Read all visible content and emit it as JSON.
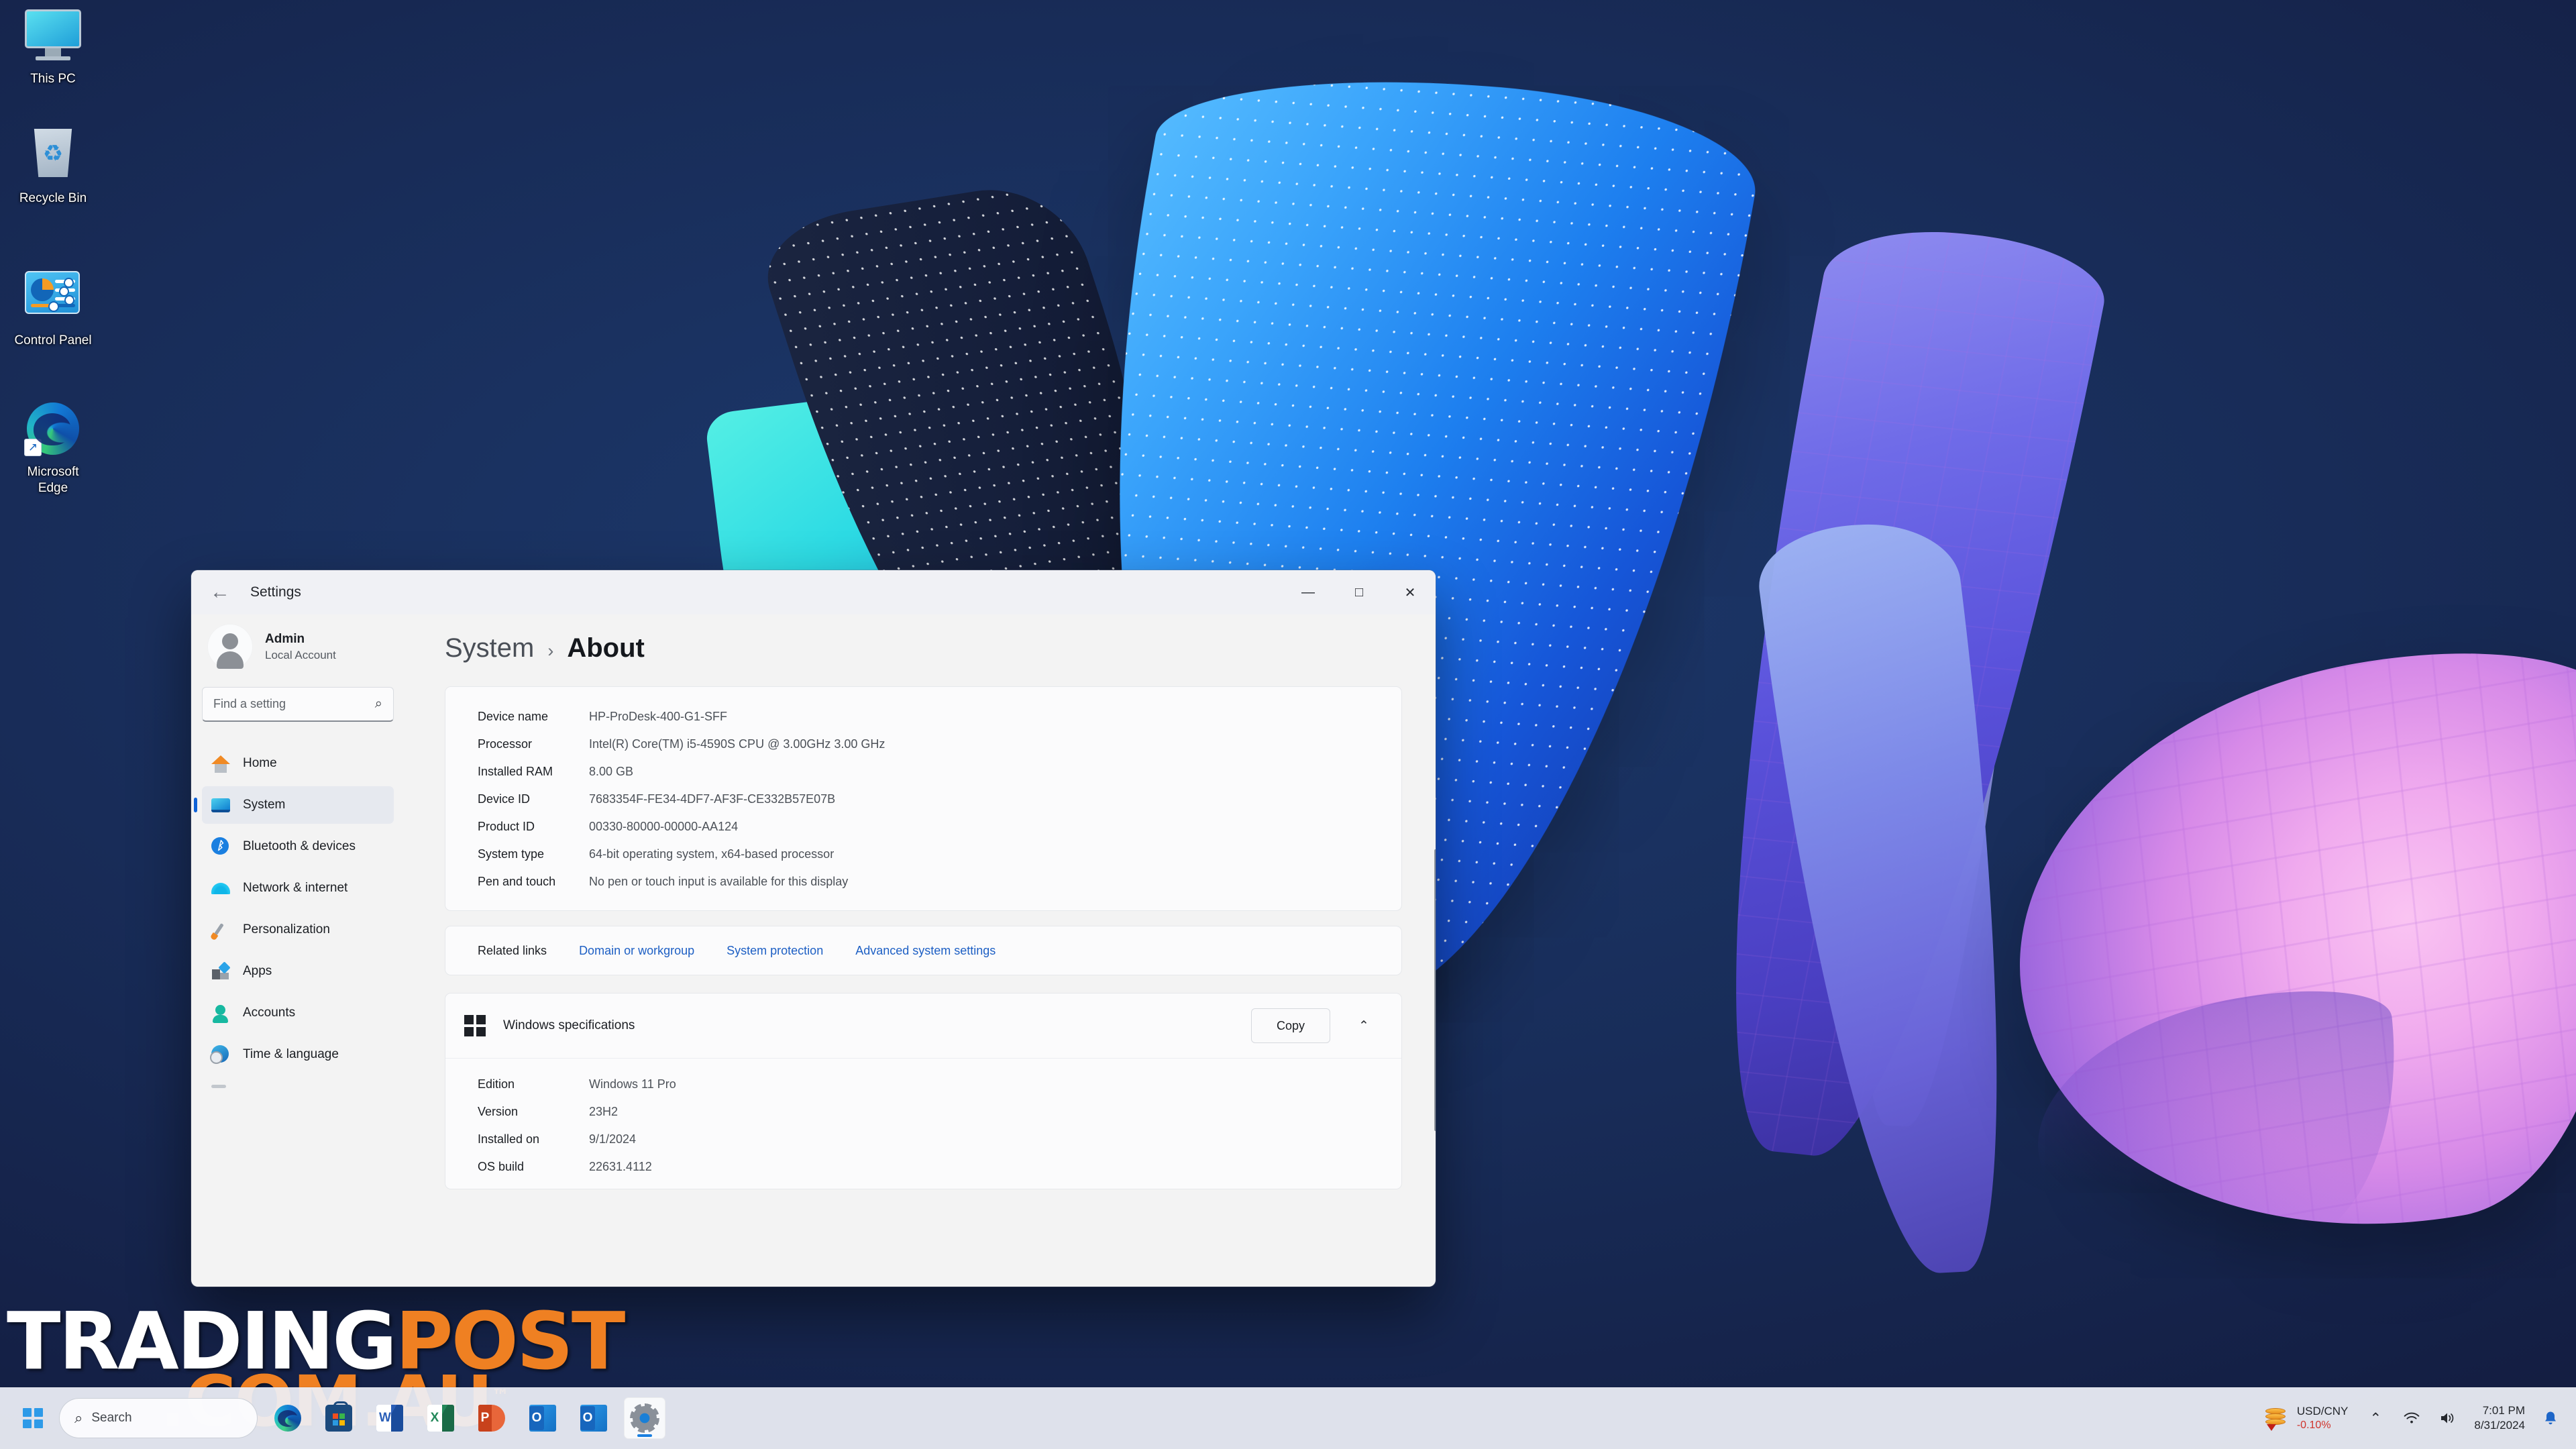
{
  "desktop": {
    "icons": [
      {
        "label": "This PC",
        "icon": "this-pc-icon"
      },
      {
        "label": "Recycle Bin",
        "icon": "recycle-bin-icon"
      },
      {
        "label": "Control Panel",
        "icon": "control-panel-icon"
      },
      {
        "label": "Microsoft\nEdge",
        "icon": "microsoft-edge-icon"
      }
    ]
  },
  "watermark": {
    "part1": "TRADING",
    "part2": "POST",
    "part3": ".COM.AU",
    "tm": "™",
    "color_white": "#ffffff",
    "color_orange": "#ef8022"
  },
  "window": {
    "title": "Settings",
    "back_label": "←",
    "controls": {
      "minimize": "—",
      "maximize": "□",
      "close": "✕"
    }
  },
  "sidebar": {
    "profile": {
      "name": "Admin",
      "subtitle": "Local Account"
    },
    "search": {
      "placeholder": "Find a setting",
      "value": "",
      "icon": "search-icon"
    },
    "items": [
      {
        "label": "Home",
        "icon": "home-icon",
        "active": false
      },
      {
        "label": "System",
        "icon": "system-monitor-icon",
        "active": true
      },
      {
        "label": "Bluetooth & devices",
        "icon": "bluetooth-icon",
        "active": false
      },
      {
        "label": "Network & internet",
        "icon": "wifi-icon",
        "active": false
      },
      {
        "label": "Personalization",
        "icon": "paintbrush-icon",
        "active": false
      },
      {
        "label": "Apps",
        "icon": "apps-icon",
        "active": false
      },
      {
        "label": "Accounts",
        "icon": "account-person-icon",
        "active": false
      },
      {
        "label": "Time & language",
        "icon": "clock-globe-icon",
        "active": false
      }
    ]
  },
  "content": {
    "breadcrumb": {
      "parent": "System",
      "separator": "›",
      "current": "About"
    },
    "device_specs": [
      {
        "key": "Device name",
        "value": "HP-ProDesk-400-G1-SFF"
      },
      {
        "key": "Processor",
        "value": "Intel(R) Core(TM) i5-4590S CPU @ 3.00GHz   3.00 GHz"
      },
      {
        "key": "Installed RAM",
        "value": "8.00 GB"
      },
      {
        "key": "Device ID",
        "value": "7683354F-FE34-4DF7-AF3F-CE332B57E07B"
      },
      {
        "key": "Product ID",
        "value": "00330-80000-00000-AA124"
      },
      {
        "key": "System type",
        "value": "64-bit operating system, x64-based processor"
      },
      {
        "key": "Pen and touch",
        "value": "No pen or touch input is available for this display"
      }
    ],
    "related": {
      "label": "Related links",
      "links": [
        "Domain or workgroup",
        "System protection",
        "Advanced system settings"
      ],
      "link_color": "#1d5fc4"
    },
    "windows_specifications": {
      "title": "Windows specifications",
      "icon": "windows-logo-icon",
      "copy_label": "Copy",
      "chevron": "⌃",
      "rows": [
        {
          "key": "Edition",
          "value": "Windows 11 Pro"
        },
        {
          "key": "Version",
          "value": "23H2"
        },
        {
          "key": "Installed on",
          "value": "9/1/2024"
        },
        {
          "key": "OS build",
          "value": "22631.4112"
        }
      ]
    }
  },
  "taskbar": {
    "start": {
      "icon": "windows-start-icon"
    },
    "search": {
      "placeholder": "Search",
      "icon": "search-icon"
    },
    "apps": [
      {
        "name": "Microsoft Edge",
        "icon": "edge-icon",
        "active": false
      },
      {
        "name": "Microsoft Store",
        "icon": "store-icon",
        "active": false
      },
      {
        "name": "Word",
        "icon": "word-icon",
        "letter": "W",
        "active": false
      },
      {
        "name": "Excel",
        "icon": "excel-icon",
        "letter": "X",
        "active": false
      },
      {
        "name": "PowerPoint",
        "icon": "powerpoint-icon",
        "letter": "P",
        "active": false
      },
      {
        "name": "Outlook",
        "icon": "outlook-icon",
        "letter": "O",
        "active": false
      },
      {
        "name": "Outlook Classic",
        "icon": "outlook-classic-icon",
        "letter": "O",
        "active": false
      },
      {
        "name": "Settings",
        "icon": "settings-gear-icon",
        "active": true
      }
    ],
    "tray": {
      "stock": {
        "pair": "USD/CNY",
        "change": "-0.10%",
        "icon": "coins-down-icon",
        "change_color": "#d0342c"
      },
      "overflow_icon": "chevron-up-icon",
      "wifi_icon": "wifi-icon",
      "volume_icon": "speaker-icon",
      "clock": {
        "time": "7:01 PM",
        "date": "8/31/2024"
      },
      "notification_icon": "bell-icon"
    }
  }
}
